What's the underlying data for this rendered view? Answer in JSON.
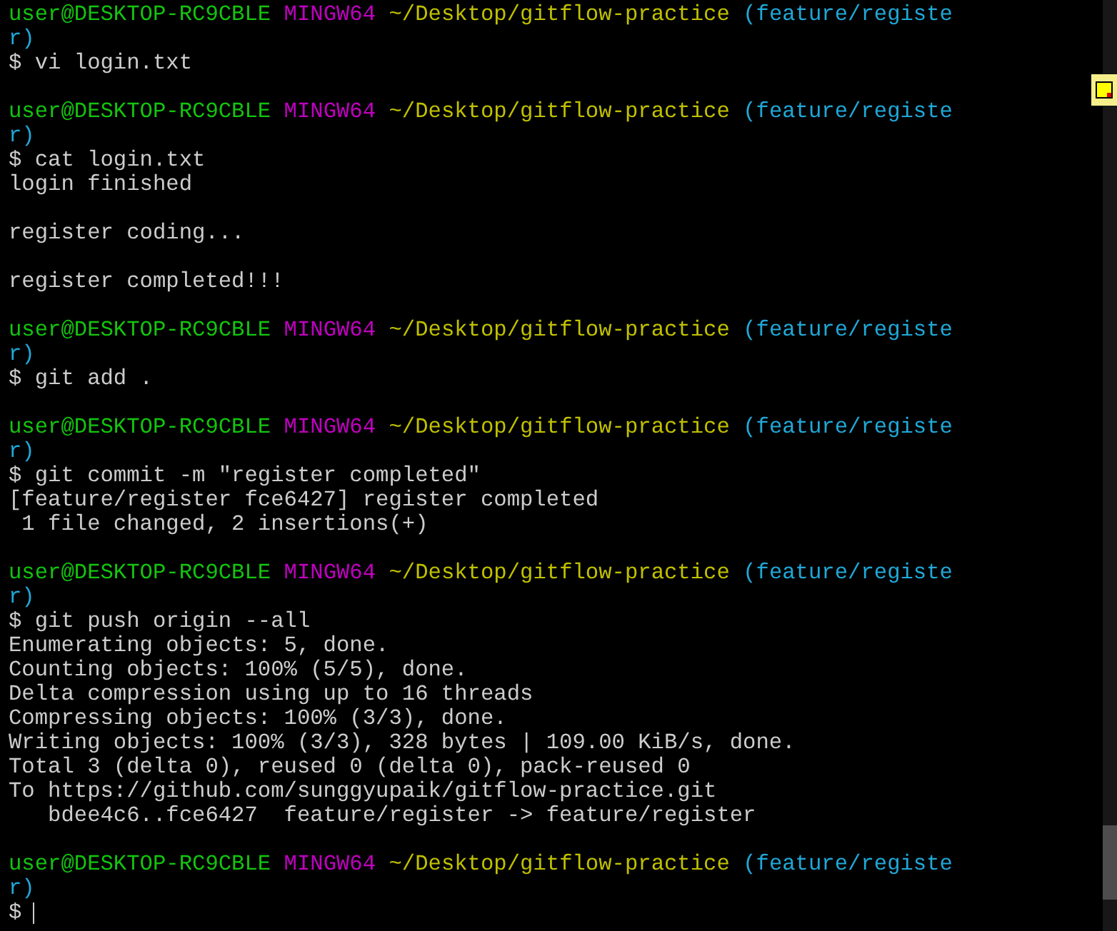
{
  "entries": [
    {
      "prompt": {
        "user": "user@DESKTOP-RC9CBLE",
        "system": "MINGW64",
        "path": "~/Desktop/gitflow-practice",
        "branch": "(feature/registe",
        "branch_wrap": "r)"
      },
      "command": "$ vi login.txt"
    },
    {
      "prompt": {
        "user": "user@DESKTOP-RC9CBLE",
        "system": "MINGW64",
        "path": "~/Desktop/gitflow-practice",
        "branch": "(feature/registe",
        "branch_wrap": "r)"
      },
      "command": "$ cat login.txt",
      "output": [
        [
          "login finished"
        ],
        [
          "register coding..."
        ],
        [
          "register completed!!!"
        ]
      ]
    },
    {
      "prompt": {
        "user": "user@DESKTOP-RC9CBLE",
        "system": "MINGW64",
        "path": "~/Desktop/gitflow-practice",
        "branch": "(feature/registe",
        "branch_wrap": "r)"
      },
      "command": "$ git add ."
    },
    {
      "prompt": {
        "user": "user@DESKTOP-RC9CBLE",
        "system": "MINGW64",
        "path": "~/Desktop/gitflow-practice",
        "branch": "(feature/registe",
        "branch_wrap": "r)"
      },
      "command": "$ git commit -m \"register completed\"",
      "output": [
        [
          "[feature/register fce6427] register completed",
          " 1 file changed, 2 insertions(+)"
        ]
      ]
    },
    {
      "prompt": {
        "user": "user@DESKTOP-RC9CBLE",
        "system": "MINGW64",
        "path": "~/Desktop/gitflow-practice",
        "branch": "(feature/registe",
        "branch_wrap": "r)"
      },
      "command": "$ git push origin --all",
      "output": [
        [
          "Enumerating objects: 5, done.",
          "Counting objects: 100% (5/5), done.",
          "Delta compression using up to 16 threads",
          "Compressing objects: 100% (3/3), done.",
          "Writing objects: 100% (3/3), 328 bytes | 109.00 KiB/s, done.",
          "Total 3 (delta 0), reused 0 (delta 0), pack-reused 0",
          "To https://github.com/sunggyupaik/gitflow-practice.git",
          "   bdee4c6..fce6427  feature/register -> feature/register"
        ]
      ]
    },
    {
      "prompt": {
        "user": "user@DESKTOP-RC9CBLE",
        "system": "MINGW64",
        "path": "~/Desktop/gitflow-practice",
        "branch": "(feature/registe",
        "branch_wrap": "r)"
      },
      "command": "$",
      "cursor": true
    }
  ]
}
